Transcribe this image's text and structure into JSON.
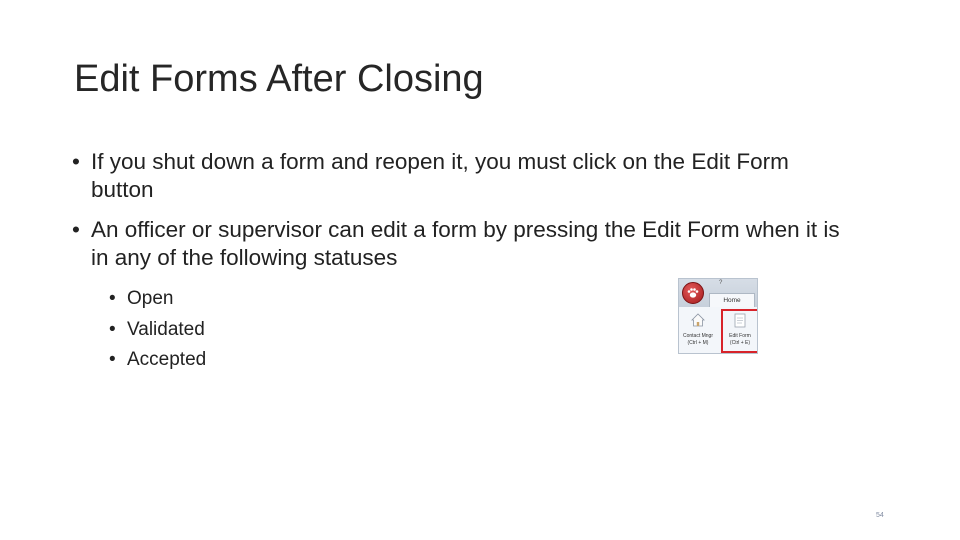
{
  "slide": {
    "title": "Edit Forms After Closing",
    "bullets": [
      "If you shut down a form and reopen it, you must click on the Edit Form button",
      "An officer or supervisor can edit a form by pressing the Edit Form when it is in any of the following statuses"
    ],
    "sub_bullets": [
      "Open",
      "Validated",
      "Accepted"
    ],
    "bullet_glyph": "•",
    "page_number": "54"
  },
  "ribbon": {
    "help": "?",
    "tab_label": "Home",
    "buttons": [
      {
        "label1": "Contact Mngr",
        "label2": "(Ctrl + M)",
        "icon": "house-icon"
      },
      {
        "label1": "Edit Form",
        "label2": "(Ctrl + E)",
        "icon": "edit-form-icon"
      }
    ],
    "highlight_color": "#d8232a",
    "logo": "paw-logo-icon"
  }
}
